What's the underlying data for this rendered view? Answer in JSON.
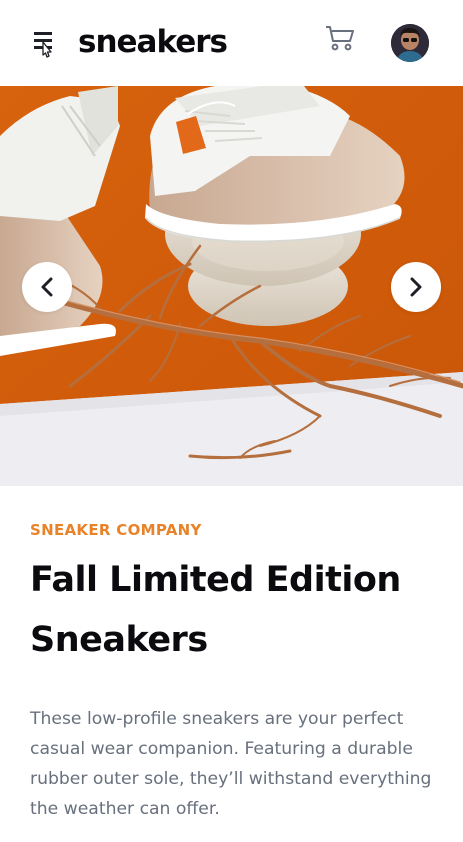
{
  "app": {
    "logo": "sneakers"
  },
  "header": {
    "menu_icon": "menu-icon",
    "cart_icon": "cart-icon",
    "avatar_icon": "user-avatar"
  },
  "gallery": {
    "prev_icon": "chevron-left-icon",
    "next_icon": "chevron-right-icon"
  },
  "product": {
    "company": "SNEAKER COMPANY",
    "title": "Fall Limited Edition Sneakers",
    "description": "These low-profile sneakers are your perfect casual wear companion. Featuring a durable rubber outer sole, they’ll withstand everything the weather can offer."
  },
  "colors": {
    "accent": "#e8832a",
    "text_dark": "#0b0b0f",
    "text_muted": "#68707d",
    "hero_orange": "#d9660f"
  }
}
